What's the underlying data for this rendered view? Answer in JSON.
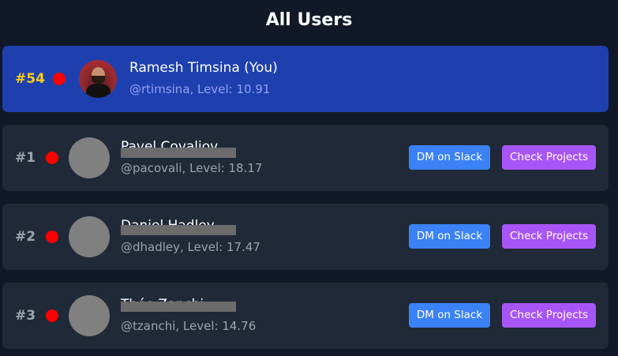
{
  "header": {
    "title": "All Users"
  },
  "current_user": {
    "rank": "#54",
    "name": "Ramesh Timsina (You)",
    "handle_level": "@rtimsina, Level: 10.91"
  },
  "users": [
    {
      "rank": "#1",
      "name": "Pavel Covaliov",
      "handle_level": "@pacovali, Level: 18.17"
    },
    {
      "rank": "#2",
      "name": "Daniel Hadley",
      "handle_level": "@dhadley, Level: 17.47"
    },
    {
      "rank": "#3",
      "name": "Théo Zanchi",
      "handle_level": "@tzanchi, Level: 14.76"
    }
  ],
  "actions": {
    "slack_label": "DM on Slack",
    "projects_label": "Check Projects"
  },
  "colors": {
    "background": "#111827",
    "card": "#1f2937",
    "highlight_card": "#1e40af",
    "status_dot": "#ff0000",
    "slack_button": "#3b82f6",
    "projects_button": "#a855f7",
    "rank_highlight": "#facc15"
  }
}
